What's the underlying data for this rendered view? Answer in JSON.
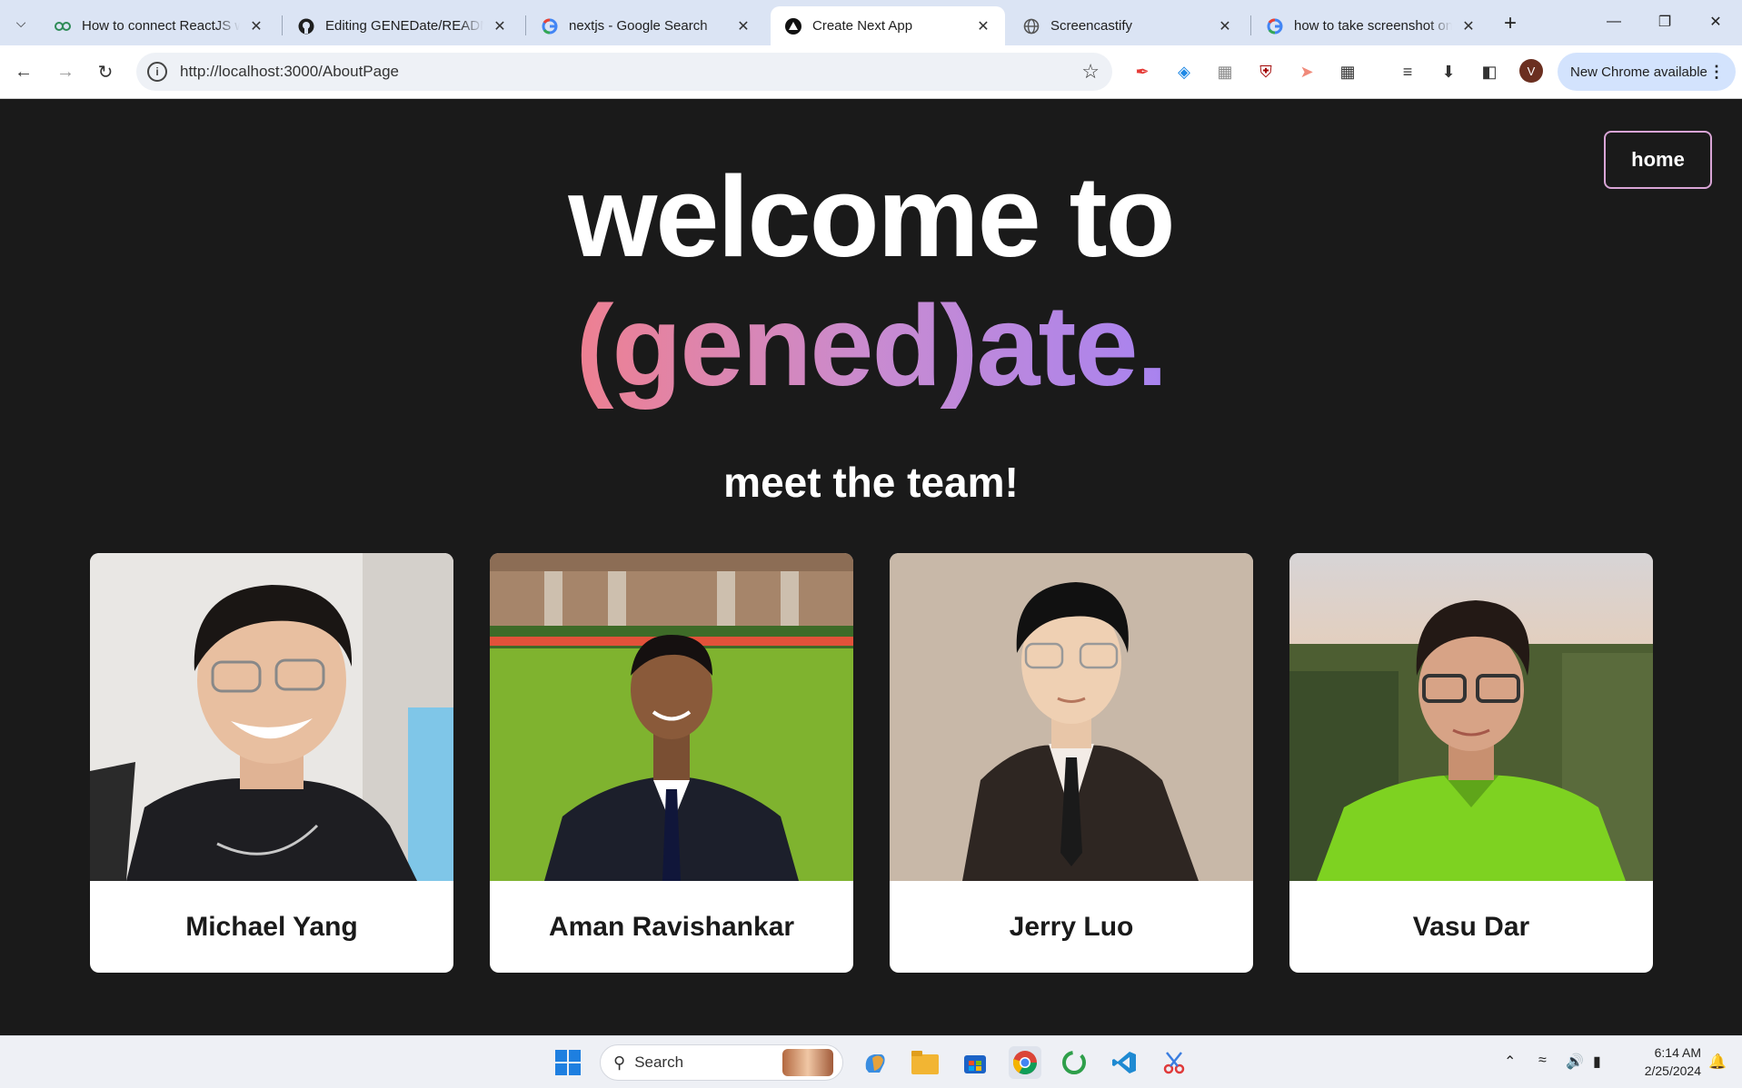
{
  "browser": {
    "tabs": [
      {
        "title": "How to connect ReactJS wi",
        "favicon": "link-icon",
        "active": false
      },
      {
        "title": "Editing GENEDate/README",
        "favicon": "github-icon",
        "active": false
      },
      {
        "title": "nextjs - Google Search",
        "favicon": "google-icon",
        "active": false
      },
      {
        "title": "Create Next App",
        "favicon": "nextjs-icon",
        "active": true
      },
      {
        "title": "Screencastify",
        "favicon": "globe-icon",
        "active": false
      },
      {
        "title": "how to take screenshot on",
        "favicon": "google-icon",
        "active": false
      }
    ],
    "url": "http://localhost:3000/AboutPage",
    "update_chip": "New Chrome available",
    "profile_initial": "V"
  },
  "page": {
    "home_label": "home",
    "hero_line1": "welcome to",
    "hero_line2": "(gened)ate.",
    "team_title": "meet the team!",
    "members": [
      {
        "name": "Michael Yang"
      },
      {
        "name": "Aman Ravishankar"
      },
      {
        "name": "Jerry Luo"
      },
      {
        "name": "Vasu Dar"
      }
    ],
    "colors": {
      "background": "#1a1a1a",
      "gradient_start": "#ee8091",
      "gradient_end": "#a883f0",
      "home_border": "#d9a5d6"
    }
  },
  "taskbar": {
    "search_label": "Search",
    "time": "6:14 AM",
    "date": "2/25/2024"
  }
}
